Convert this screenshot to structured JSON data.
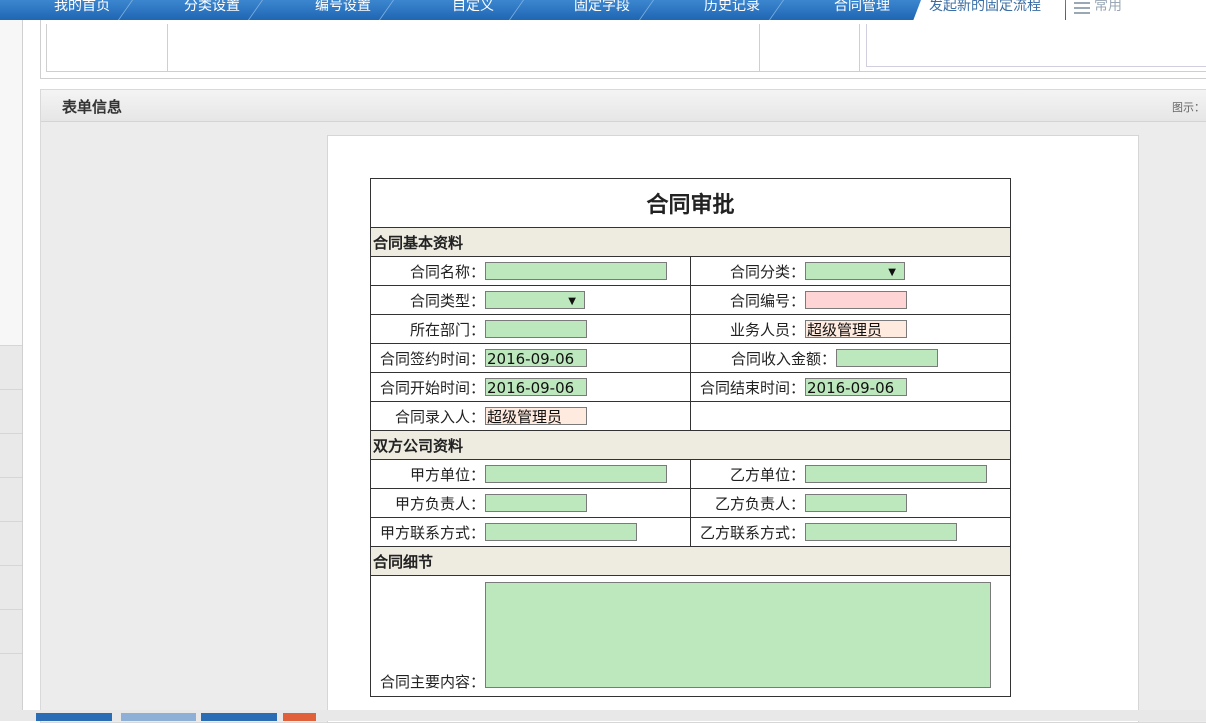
{
  "tabs": [
    {
      "label": "我的首页"
    },
    {
      "label": "分类设置"
    },
    {
      "label": "编号设置"
    },
    {
      "label": "自定义"
    },
    {
      "label": "固定字段"
    },
    {
      "label": "历史记录"
    },
    {
      "label": "合同管理"
    },
    {
      "label": "发起新的固定流程"
    }
  ],
  "common_tab": {
    "label": "常用"
  },
  "panel": {
    "title": "表单信息",
    "hint": "图示："
  },
  "form": {
    "title": "合同审批",
    "sections": {
      "basic": "合同基本资料",
      "parties": "双方公司资料",
      "details": "合同细节"
    },
    "fields": {
      "contract_name": {
        "label": "合同名称：",
        "value": ""
      },
      "contract_category": {
        "label": "合同分类：",
        "value": ""
      },
      "contract_type": {
        "label": "合同类型：",
        "value": ""
      },
      "contract_number": {
        "label": "合同编号：",
        "value": ""
      },
      "department": {
        "label": "所在部门：",
        "value": ""
      },
      "salesperson": {
        "label": "业务人员：",
        "value": "超级管理员"
      },
      "sign_date": {
        "label": "合同签约时间：",
        "value": "2016-09-06"
      },
      "income_amount": {
        "label": "合同收入金额：",
        "value": ""
      },
      "start_date": {
        "label": "合同开始时间：",
        "value": "2016-09-06"
      },
      "end_date": {
        "label": "合同结束时间：",
        "value": "2016-09-06"
      },
      "entry_person": {
        "label": "合同录入人：",
        "value": "超级管理员"
      },
      "party_a_unit": {
        "label": "甲方单位：",
        "value": ""
      },
      "party_b_unit": {
        "label": "乙方单位：",
        "value": ""
      },
      "party_a_head": {
        "label": "甲方负责人：",
        "value": ""
      },
      "party_b_head": {
        "label": "乙方负责人：",
        "value": ""
      },
      "party_a_contact": {
        "label": "甲方联系方式：",
        "value": ""
      },
      "party_b_contact": {
        "label": "乙方联系方式：",
        "value": ""
      },
      "main_content": {
        "label": "合同主要内容：",
        "value": ""
      }
    }
  },
  "colors": {
    "tabbar": "#2a75c4",
    "field_green": "#bde8bd",
    "field_pink": "#ffd4d4",
    "field_peach": "#ffeadf",
    "section_bg": "#eeebe1"
  }
}
